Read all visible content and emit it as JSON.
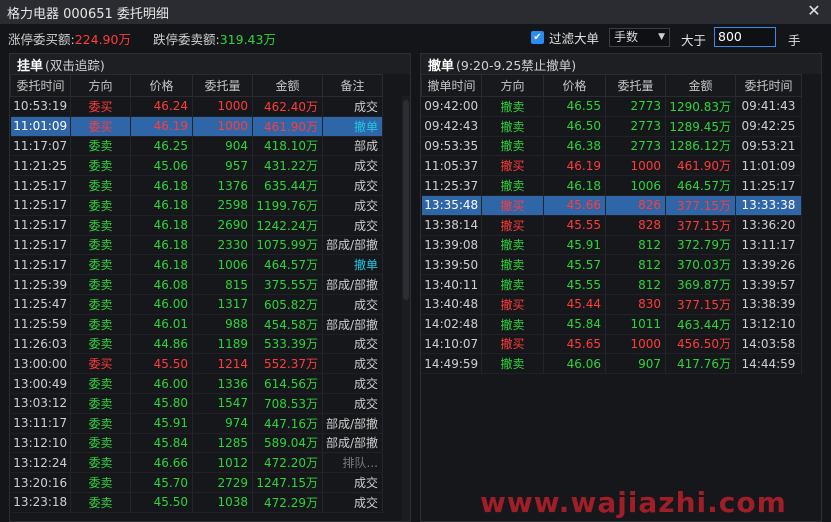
{
  "window": {
    "title": "格力电器 000651 委托明细",
    "close_glyph": "✕"
  },
  "summary": {
    "limit_up_label": "涨停委买额:",
    "limit_up_value": "224.90万",
    "limit_down_label": "跌停委卖额:",
    "limit_down_value": "319.43万"
  },
  "filter": {
    "checked": true,
    "label": "过滤大单",
    "unit_select": "手数",
    "greater_label": "大于",
    "threshold": "800",
    "unit": "手"
  },
  "colors": {
    "buy": "#ff3b3b",
    "sell": "#2ed33c",
    "cancel_status": "#1ec8e6",
    "selected_row": "#2f66a8"
  },
  "left_panel": {
    "title": "挂单",
    "subtitle": "(双击追踪)",
    "columns": [
      "委托时间",
      "方向",
      "价格",
      "委托量",
      "金额",
      "备注"
    ],
    "rows": [
      {
        "time": "10:53:19",
        "dir": "委买",
        "price": "46.24",
        "qty": "1000",
        "amount": "462.40万",
        "note": "成交",
        "side": "buy",
        "noteStyle": "normal",
        "selected": false
      },
      {
        "time": "11:01:09",
        "dir": "委买",
        "price": "46.19",
        "qty": "1000",
        "amount": "461.90万",
        "note": "撤单",
        "side": "buy",
        "noteStyle": "cancel",
        "selected": true
      },
      {
        "time": "11:17:07",
        "dir": "委卖",
        "price": "46.25",
        "qty": "904",
        "amount": "418.10万",
        "note": "部成",
        "side": "sell",
        "noteStyle": "normal",
        "selected": false
      },
      {
        "time": "11:21:25",
        "dir": "委卖",
        "price": "45.06",
        "qty": "957",
        "amount": "431.22万",
        "note": "成交",
        "side": "sell",
        "noteStyle": "normal",
        "selected": false
      },
      {
        "time": "11:25:17",
        "dir": "委卖",
        "price": "46.18",
        "qty": "1376",
        "amount": "635.44万",
        "note": "成交",
        "side": "sell",
        "noteStyle": "normal",
        "selected": false
      },
      {
        "time": "11:25:17",
        "dir": "委卖",
        "price": "46.18",
        "qty": "2598",
        "amount": "1199.76万",
        "note": "成交",
        "side": "sell",
        "noteStyle": "normal",
        "selected": false
      },
      {
        "time": "11:25:17",
        "dir": "委卖",
        "price": "46.18",
        "qty": "2690",
        "amount": "1242.24万",
        "note": "成交",
        "side": "sell",
        "noteStyle": "normal",
        "selected": false
      },
      {
        "time": "11:25:17",
        "dir": "委卖",
        "price": "46.18",
        "qty": "2330",
        "amount": "1075.99万",
        "note": "部成/部撤",
        "side": "sell",
        "noteStyle": "normal",
        "selected": false
      },
      {
        "time": "11:25:17",
        "dir": "委卖",
        "price": "46.18",
        "qty": "1006",
        "amount": "464.57万",
        "note": "撤单",
        "side": "sell",
        "noteStyle": "cancel",
        "selected": false
      },
      {
        "time": "11:25:39",
        "dir": "委卖",
        "price": "46.08",
        "qty": "815",
        "amount": "375.55万",
        "note": "部成/部撤",
        "side": "sell",
        "noteStyle": "normal",
        "selected": false
      },
      {
        "time": "11:25:47",
        "dir": "委卖",
        "price": "46.00",
        "qty": "1317",
        "amount": "605.82万",
        "note": "成交",
        "side": "sell",
        "noteStyle": "normal",
        "selected": false
      },
      {
        "time": "11:25:59",
        "dir": "委卖",
        "price": "46.01",
        "qty": "988",
        "amount": "454.58万",
        "note": "部成/部撤",
        "side": "sell",
        "noteStyle": "normal",
        "selected": false
      },
      {
        "time": "11:26:03",
        "dir": "委卖",
        "price": "44.86",
        "qty": "1189",
        "amount": "533.39万",
        "note": "成交",
        "side": "sell",
        "noteStyle": "normal",
        "selected": false
      },
      {
        "time": "13:00:00",
        "dir": "委买",
        "price": "45.50",
        "qty": "1214",
        "amount": "552.37万",
        "note": "成交",
        "side": "buy",
        "noteStyle": "normal",
        "selected": false
      },
      {
        "time": "13:00:49",
        "dir": "委卖",
        "price": "46.00",
        "qty": "1336",
        "amount": "614.56万",
        "note": "成交",
        "side": "sell",
        "noteStyle": "normal",
        "selected": false
      },
      {
        "time": "13:03:12",
        "dir": "委卖",
        "price": "45.80",
        "qty": "1547",
        "amount": "708.53万",
        "note": "成交",
        "side": "sell",
        "noteStyle": "normal",
        "selected": false
      },
      {
        "time": "13:11:17",
        "dir": "委卖",
        "price": "45.91",
        "qty": "974",
        "amount": "447.16万",
        "note": "部成/部撤",
        "side": "sell",
        "noteStyle": "normal",
        "selected": false
      },
      {
        "time": "13:12:10",
        "dir": "委卖",
        "price": "45.84",
        "qty": "1285",
        "amount": "589.04万",
        "note": "部成/部撤",
        "side": "sell",
        "noteStyle": "normal",
        "selected": false
      },
      {
        "time": "13:12:24",
        "dir": "委卖",
        "price": "46.66",
        "qty": "1012",
        "amount": "472.20万",
        "note": "排队...",
        "side": "sell",
        "noteStyle": "muted",
        "selected": false
      },
      {
        "time": "13:20:16",
        "dir": "委卖",
        "price": "45.70",
        "qty": "2729",
        "amount": "1247.15万",
        "note": "成交",
        "side": "sell",
        "noteStyle": "normal",
        "selected": false
      },
      {
        "time": "13:23:18",
        "dir": "委卖",
        "price": "45.50",
        "qty": "1038",
        "amount": "472.29万",
        "note": "成交",
        "side": "sell",
        "noteStyle": "normal",
        "selected": false
      }
    ]
  },
  "right_panel": {
    "title": "撤单",
    "subtitle": "(9:20-9.25禁止撤单)",
    "columns": [
      "撤单时间",
      "方向",
      "价格",
      "委托量",
      "金额",
      "委托时间"
    ],
    "rows": [
      {
        "time": "09:42:00",
        "dir": "撤卖",
        "price": "46.55",
        "qty": "2773",
        "amount": "1290.83万",
        "otime": "09:41:43",
        "side": "sell",
        "selected": false
      },
      {
        "time": "09:42:43",
        "dir": "撤卖",
        "price": "46.50",
        "qty": "2773",
        "amount": "1289.45万",
        "otime": "09:42:25",
        "side": "sell",
        "selected": false
      },
      {
        "time": "09:53:35",
        "dir": "撤卖",
        "price": "46.38",
        "qty": "2773",
        "amount": "1286.12万",
        "otime": "09:53:21",
        "side": "sell",
        "selected": false
      },
      {
        "time": "11:05:37",
        "dir": "撤买",
        "price": "46.19",
        "qty": "1000",
        "amount": "461.90万",
        "otime": "11:01:09",
        "side": "buy",
        "selected": false
      },
      {
        "time": "11:25:37",
        "dir": "撤卖",
        "price": "46.18",
        "qty": "1006",
        "amount": "464.57万",
        "otime": "11:25:17",
        "side": "sell",
        "selected": false
      },
      {
        "time": "13:35:48",
        "dir": "撤买",
        "price": "45.66",
        "qty": "826",
        "amount": "377.15万",
        "otime": "13:33:38",
        "side": "buy",
        "selected": true
      },
      {
        "time": "13:38:14",
        "dir": "撤买",
        "price": "45.55",
        "qty": "828",
        "amount": "377.15万",
        "otime": "13:36:20",
        "side": "buy",
        "selected": false
      },
      {
        "time": "13:39:08",
        "dir": "撤卖",
        "price": "45.91",
        "qty": "812",
        "amount": "372.79万",
        "otime": "13:11:17",
        "side": "sell",
        "selected": false
      },
      {
        "time": "13:39:50",
        "dir": "撤卖",
        "price": "45.57",
        "qty": "812",
        "amount": "370.03万",
        "otime": "13:39:26",
        "side": "sell",
        "selected": false
      },
      {
        "time": "13:40:11",
        "dir": "撤卖",
        "price": "45.55",
        "qty": "812",
        "amount": "369.87万",
        "otime": "13:39:57",
        "side": "sell",
        "selected": false
      },
      {
        "time": "13:40:48",
        "dir": "撤买",
        "price": "45.44",
        "qty": "830",
        "amount": "377.15万",
        "otime": "13:38:39",
        "side": "buy",
        "selected": false
      },
      {
        "time": "14:02:48",
        "dir": "撤卖",
        "price": "45.84",
        "qty": "1011",
        "amount": "463.44万",
        "otime": "13:12:10",
        "side": "sell",
        "selected": false
      },
      {
        "time": "14:10:07",
        "dir": "撤买",
        "price": "45.65",
        "qty": "1000",
        "amount": "456.50万",
        "otime": "14:03:58",
        "side": "buy",
        "selected": false
      },
      {
        "time": "14:49:59",
        "dir": "撤卖",
        "price": "46.06",
        "qty": "907",
        "amount": "417.76万",
        "otime": "14:44:59",
        "side": "sell",
        "selected": false
      }
    ]
  },
  "watermark": "www.wajiazhi.com"
}
